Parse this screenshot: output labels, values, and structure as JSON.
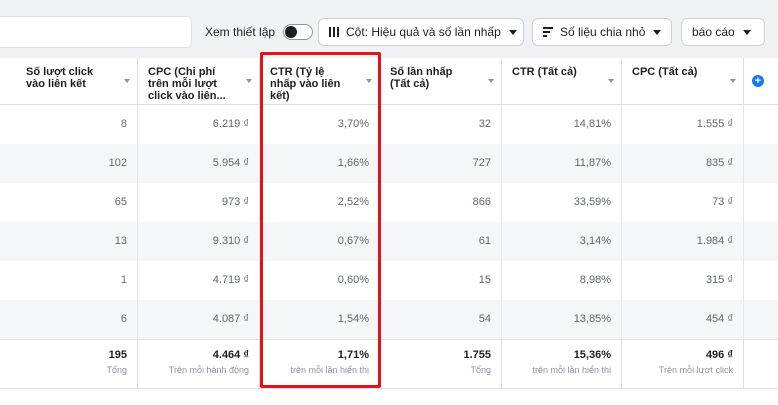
{
  "toolbar": {
    "view_setup_label": "Xem thiết lập",
    "columns_label": "Cột: Hiệu quả và số lần nhấp",
    "breakdown_label": "Số liệu chia nhỏ",
    "reports_label": "báo cáo",
    "toggle_state": "off"
  },
  "table": {
    "columns": [
      {
        "header": "Số lượt click\nvào liên kết"
      },
      {
        "header": "CPC (Chi phí\ntrên mỗi lượt\nclick vào liên..."
      },
      {
        "header": "CTR (Tỷ lệ\nnhấp vào liên\nkết)"
      },
      {
        "header": "Số lần nhấp\n(Tất cả)"
      },
      {
        "header": "CTR (Tất cả)"
      },
      {
        "header": "CPC (Tất cả)"
      }
    ],
    "rows": [
      [
        "8",
        "6.219 ₫",
        "3,70%",
        "32",
        "14,81%",
        "1.555 ₫"
      ],
      [
        "102",
        "5.954 ₫",
        "1,66%",
        "727",
        "11,87%",
        "835 ₫"
      ],
      [
        "65",
        "973 ₫",
        "2,52%",
        "866",
        "33,59%",
        "73 ₫"
      ],
      [
        "13",
        "9.310 ₫",
        "0,67%",
        "61",
        "3,14%",
        "1.984 ₫"
      ],
      [
        "1",
        "4.719 ₫",
        "0,60%",
        "15",
        "8,98%",
        "315 ₫"
      ],
      [
        "6",
        "4.087 ₫",
        "1,54%",
        "54",
        "13,85%",
        "454 ₫"
      ]
    ],
    "totals": [
      {
        "value": "195",
        "label": "Tổng"
      },
      {
        "value": "4.464 ₫",
        "label": "Trên mỗi hành động"
      },
      {
        "value": "1,71%",
        "label": "trên mỗi lần hiển thị"
      },
      {
        "value": "1.755",
        "label": "Tổng"
      },
      {
        "value": "15,36%",
        "label": "trên mỗi lần hiển thị"
      },
      {
        "value": "496 ₫",
        "label": "Trên mỗi lượt click"
      }
    ]
  },
  "colors": {
    "accent": "#1877f2",
    "highlight": "#e4121b",
    "row_alt": "#f5f6f7"
  }
}
